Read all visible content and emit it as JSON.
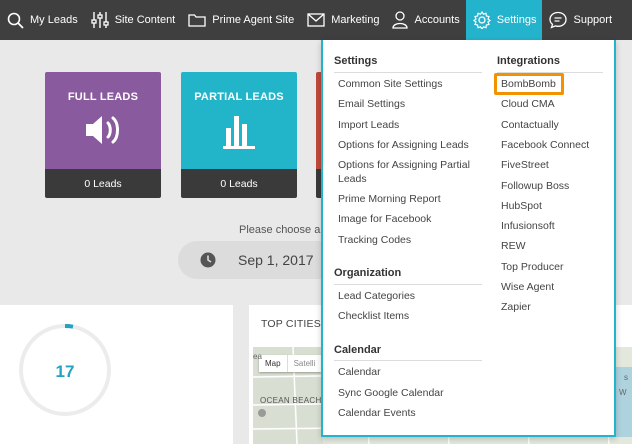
{
  "nav": {
    "items": [
      {
        "label": "My Leads",
        "icon": "search-icon"
      },
      {
        "label": "Site Content",
        "icon": "sliders-icon"
      },
      {
        "label": "Prime Agent Site",
        "icon": "folder-icon"
      },
      {
        "label": "Marketing",
        "icon": "envelope-icon"
      },
      {
        "label": "Accounts",
        "icon": "user-icon"
      },
      {
        "label": "Settings",
        "icon": "gear-icon"
      },
      {
        "label": "Support",
        "icon": "chat-icon"
      }
    ],
    "active": "Settings",
    "accent": "#24b3cc"
  },
  "tiles": [
    {
      "title": "FULL LEADS",
      "count": "0 Leads",
      "icon": "volume-icon",
      "color": "#8a5a9e"
    },
    {
      "title": "PARTIAL LEADS",
      "count": "0 Leads",
      "icon": "bar-chart-icon",
      "color": "#22b4c9"
    }
  ],
  "date_picker": {
    "prompt": "Please choose a",
    "value": "Sep 1, 2017"
  },
  "gauge": {
    "value": "17"
  },
  "map_panel": {
    "title": "TOP CITIES",
    "map_button": "Map",
    "satellite_button": "Satelli",
    "place_label": "OCEAN BEACH",
    "side_label_1": "ea",
    "side_label_2": "W",
    "side_label_3": "s"
  },
  "dropdown": {
    "settings_head": "Settings",
    "settings_items": [
      "Common Site Settings",
      "Email Settings",
      "Import Leads",
      "Options for Assigning Leads",
      "Options for Assigning Partial",
      "Leads",
      "Prime Morning Report",
      "Image for Facebook",
      "Tracking Codes"
    ],
    "organization_head": "Organization",
    "organization_items": [
      "Lead Categories",
      "Checklist Items"
    ],
    "calendar_head": "Calendar",
    "calendar_items": [
      "Calendar",
      "Sync Google Calendar",
      "Calendar Events"
    ],
    "integrations_head": "Integrations",
    "integrations_items": [
      "BombBomb",
      "Cloud CMA",
      "Contactually",
      "Facebook Connect",
      "FiveStreet",
      "Followup Boss",
      "HubSpot",
      "Infusionsoft",
      "REW",
      "Top Producer",
      "Wise Agent",
      "Zapier"
    ],
    "highlight_color": "#f39200"
  }
}
